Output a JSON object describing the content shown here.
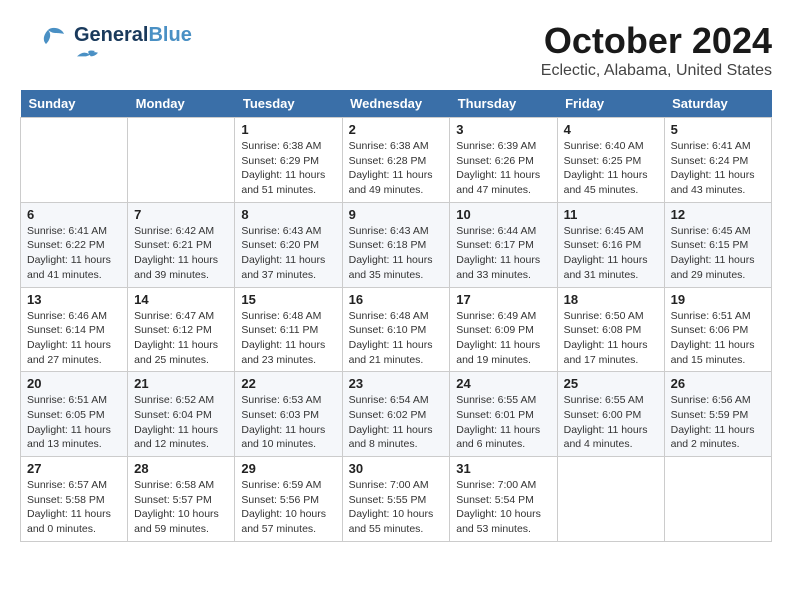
{
  "header": {
    "logo_general": "General",
    "logo_blue": "Blue",
    "title": "October 2024",
    "subtitle": "Eclectic, Alabama, United States"
  },
  "weekdays": [
    "Sunday",
    "Monday",
    "Tuesday",
    "Wednesday",
    "Thursday",
    "Friday",
    "Saturday"
  ],
  "weeks": [
    [
      {
        "day": "",
        "info": ""
      },
      {
        "day": "",
        "info": ""
      },
      {
        "day": "1",
        "info": "Sunrise: 6:38 AM\nSunset: 6:29 PM\nDaylight: 11 hours and 51 minutes."
      },
      {
        "day": "2",
        "info": "Sunrise: 6:38 AM\nSunset: 6:28 PM\nDaylight: 11 hours and 49 minutes."
      },
      {
        "day": "3",
        "info": "Sunrise: 6:39 AM\nSunset: 6:26 PM\nDaylight: 11 hours and 47 minutes."
      },
      {
        "day": "4",
        "info": "Sunrise: 6:40 AM\nSunset: 6:25 PM\nDaylight: 11 hours and 45 minutes."
      },
      {
        "day": "5",
        "info": "Sunrise: 6:41 AM\nSunset: 6:24 PM\nDaylight: 11 hours and 43 minutes."
      }
    ],
    [
      {
        "day": "6",
        "info": "Sunrise: 6:41 AM\nSunset: 6:22 PM\nDaylight: 11 hours and 41 minutes."
      },
      {
        "day": "7",
        "info": "Sunrise: 6:42 AM\nSunset: 6:21 PM\nDaylight: 11 hours and 39 minutes."
      },
      {
        "day": "8",
        "info": "Sunrise: 6:43 AM\nSunset: 6:20 PM\nDaylight: 11 hours and 37 minutes."
      },
      {
        "day": "9",
        "info": "Sunrise: 6:43 AM\nSunset: 6:18 PM\nDaylight: 11 hours and 35 minutes."
      },
      {
        "day": "10",
        "info": "Sunrise: 6:44 AM\nSunset: 6:17 PM\nDaylight: 11 hours and 33 minutes."
      },
      {
        "day": "11",
        "info": "Sunrise: 6:45 AM\nSunset: 6:16 PM\nDaylight: 11 hours and 31 minutes."
      },
      {
        "day": "12",
        "info": "Sunrise: 6:45 AM\nSunset: 6:15 PM\nDaylight: 11 hours and 29 minutes."
      }
    ],
    [
      {
        "day": "13",
        "info": "Sunrise: 6:46 AM\nSunset: 6:14 PM\nDaylight: 11 hours and 27 minutes."
      },
      {
        "day": "14",
        "info": "Sunrise: 6:47 AM\nSunset: 6:12 PM\nDaylight: 11 hours and 25 minutes."
      },
      {
        "day": "15",
        "info": "Sunrise: 6:48 AM\nSunset: 6:11 PM\nDaylight: 11 hours and 23 minutes."
      },
      {
        "day": "16",
        "info": "Sunrise: 6:48 AM\nSunset: 6:10 PM\nDaylight: 11 hours and 21 minutes."
      },
      {
        "day": "17",
        "info": "Sunrise: 6:49 AM\nSunset: 6:09 PM\nDaylight: 11 hours and 19 minutes."
      },
      {
        "day": "18",
        "info": "Sunrise: 6:50 AM\nSunset: 6:08 PM\nDaylight: 11 hours and 17 minutes."
      },
      {
        "day": "19",
        "info": "Sunrise: 6:51 AM\nSunset: 6:06 PM\nDaylight: 11 hours and 15 minutes."
      }
    ],
    [
      {
        "day": "20",
        "info": "Sunrise: 6:51 AM\nSunset: 6:05 PM\nDaylight: 11 hours and 13 minutes."
      },
      {
        "day": "21",
        "info": "Sunrise: 6:52 AM\nSunset: 6:04 PM\nDaylight: 11 hours and 12 minutes."
      },
      {
        "day": "22",
        "info": "Sunrise: 6:53 AM\nSunset: 6:03 PM\nDaylight: 11 hours and 10 minutes."
      },
      {
        "day": "23",
        "info": "Sunrise: 6:54 AM\nSunset: 6:02 PM\nDaylight: 11 hours and 8 minutes."
      },
      {
        "day": "24",
        "info": "Sunrise: 6:55 AM\nSunset: 6:01 PM\nDaylight: 11 hours and 6 minutes."
      },
      {
        "day": "25",
        "info": "Sunrise: 6:55 AM\nSunset: 6:00 PM\nDaylight: 11 hours and 4 minutes."
      },
      {
        "day": "26",
        "info": "Sunrise: 6:56 AM\nSunset: 5:59 PM\nDaylight: 11 hours and 2 minutes."
      }
    ],
    [
      {
        "day": "27",
        "info": "Sunrise: 6:57 AM\nSunset: 5:58 PM\nDaylight: 11 hours and 0 minutes."
      },
      {
        "day": "28",
        "info": "Sunrise: 6:58 AM\nSunset: 5:57 PM\nDaylight: 10 hours and 59 minutes."
      },
      {
        "day": "29",
        "info": "Sunrise: 6:59 AM\nSunset: 5:56 PM\nDaylight: 10 hours and 57 minutes."
      },
      {
        "day": "30",
        "info": "Sunrise: 7:00 AM\nSunset: 5:55 PM\nDaylight: 10 hours and 55 minutes."
      },
      {
        "day": "31",
        "info": "Sunrise: 7:00 AM\nSunset: 5:54 PM\nDaylight: 10 hours and 53 minutes."
      },
      {
        "day": "",
        "info": ""
      },
      {
        "day": "",
        "info": ""
      }
    ]
  ]
}
